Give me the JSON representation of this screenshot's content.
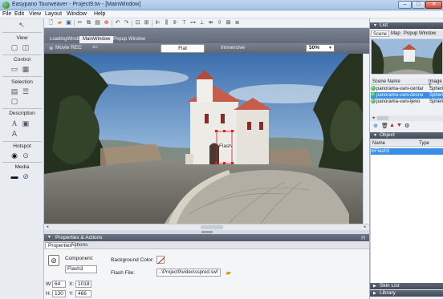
{
  "window": {
    "title": "Easypano Tourweaver - Project9.tw - [MainWindow]",
    "controls": {
      "minimize": "–",
      "maximize": "□",
      "close": "✕"
    }
  },
  "menu": [
    "File",
    "Edit",
    "View",
    "Layout",
    "Window",
    "Help"
  ],
  "left_sidebar": {
    "sections": [
      "View",
      "Control",
      "Selection",
      "Description",
      "Hotspot",
      "Media"
    ]
  },
  "document_tabs": [
    "LoadingWindow",
    "MainWindow",
    "Popup Window"
  ],
  "active_document_tab": "MainWindow",
  "view_bar": {
    "movie_rec": "Movie REC",
    "flat": "Flat",
    "immersive": "Immersive",
    "zoom": "50%"
  },
  "viewport": {
    "selected_component_label": "Flash"
  },
  "properties": {
    "title": "Properties & Actions",
    "tabs": [
      "Properties",
      "Actions"
    ],
    "component_label": "Component:",
    "component_value": "Flash3",
    "background_color_label": "Background Color:",
    "flash_file_label": "Flash File:",
    "flash_file_value": "..\\Project9\\video\\sspred.swf",
    "w_label": "W:",
    "w_value": "64",
    "x_label": "X:",
    "x_value": "1018",
    "h_label": "H:",
    "h_value": "130",
    "y_label": "Y:",
    "y_value": "466"
  },
  "list_panel": {
    "title": "List",
    "tabs": [
      "Scene",
      "Map",
      "Popup Window"
    ],
    "columns": [
      "Scene Name",
      "Image T"
    ],
    "rows": [
      {
        "name": "panorama-vani-centar",
        "type": "Spheric",
        "selected": false
      },
      {
        "name": "panorama-vani-desno",
        "type": "Spheric",
        "selected": true
      },
      {
        "name": "panorama-vani-ljevo",
        "type": "Spheric",
        "selected": false
      }
    ]
  },
  "object_panel": {
    "title": "Object",
    "columns": [
      "Name",
      "Type"
    ],
    "rows": [
      {
        "name": "Flash3",
        "type": ""
      }
    ]
  },
  "bottom_panels": [
    "Skin List",
    "Library"
  ],
  "colors": {
    "titlebar": "#a5c3e6",
    "panel_header": "#4f5765",
    "selection": "#3a8ee6"
  }
}
